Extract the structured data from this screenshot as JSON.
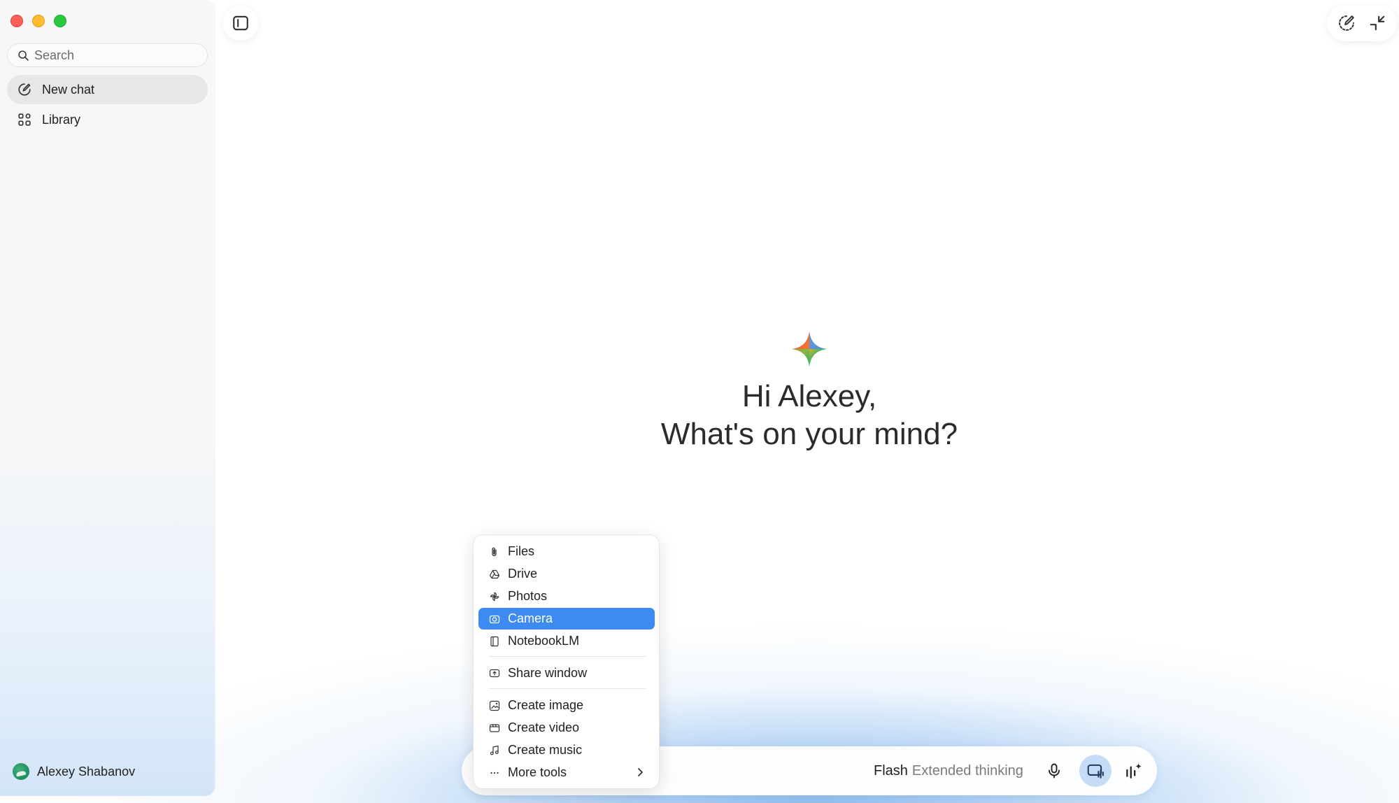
{
  "sidebar": {
    "search": {
      "placeholder": "Search"
    },
    "items": [
      {
        "label": "New chat",
        "icon": "edit-icon",
        "active": true
      },
      {
        "label": "Library",
        "icon": "grid-icon",
        "active": false
      }
    ],
    "user": {
      "name": "Alexey Shabanov"
    }
  },
  "main": {
    "greeting": {
      "line1": "Hi Alexey,",
      "line2": "What's on your mind?"
    }
  },
  "composer": {
    "model_name": "Flash",
    "model_mode": "Extended thinking"
  },
  "menu": {
    "items": [
      {
        "label": "Files",
        "icon": "paperclip-icon"
      },
      {
        "label": "Drive",
        "icon": "drive-icon"
      },
      {
        "label": "Photos",
        "icon": "photos-icon"
      },
      {
        "label": "Camera",
        "icon": "camera-icon",
        "highlighted": true
      },
      {
        "label": "NotebookLM",
        "icon": "notebook-icon"
      },
      {
        "label": "Share window",
        "icon": "share-window-icon"
      },
      {
        "label": "Create image",
        "icon": "image-icon"
      },
      {
        "label": "Create video",
        "icon": "video-icon"
      },
      {
        "label": "Create music",
        "icon": "music-icon"
      },
      {
        "label": "More tools",
        "icon": "more-icon",
        "has_submenu": true
      }
    ]
  },
  "colors": {
    "accent": "#3d8bf0",
    "sidebar_bg": "#f7f7f8",
    "active_bg": "#e7e7e8",
    "active_icon_bg": "#c6dcf6"
  }
}
